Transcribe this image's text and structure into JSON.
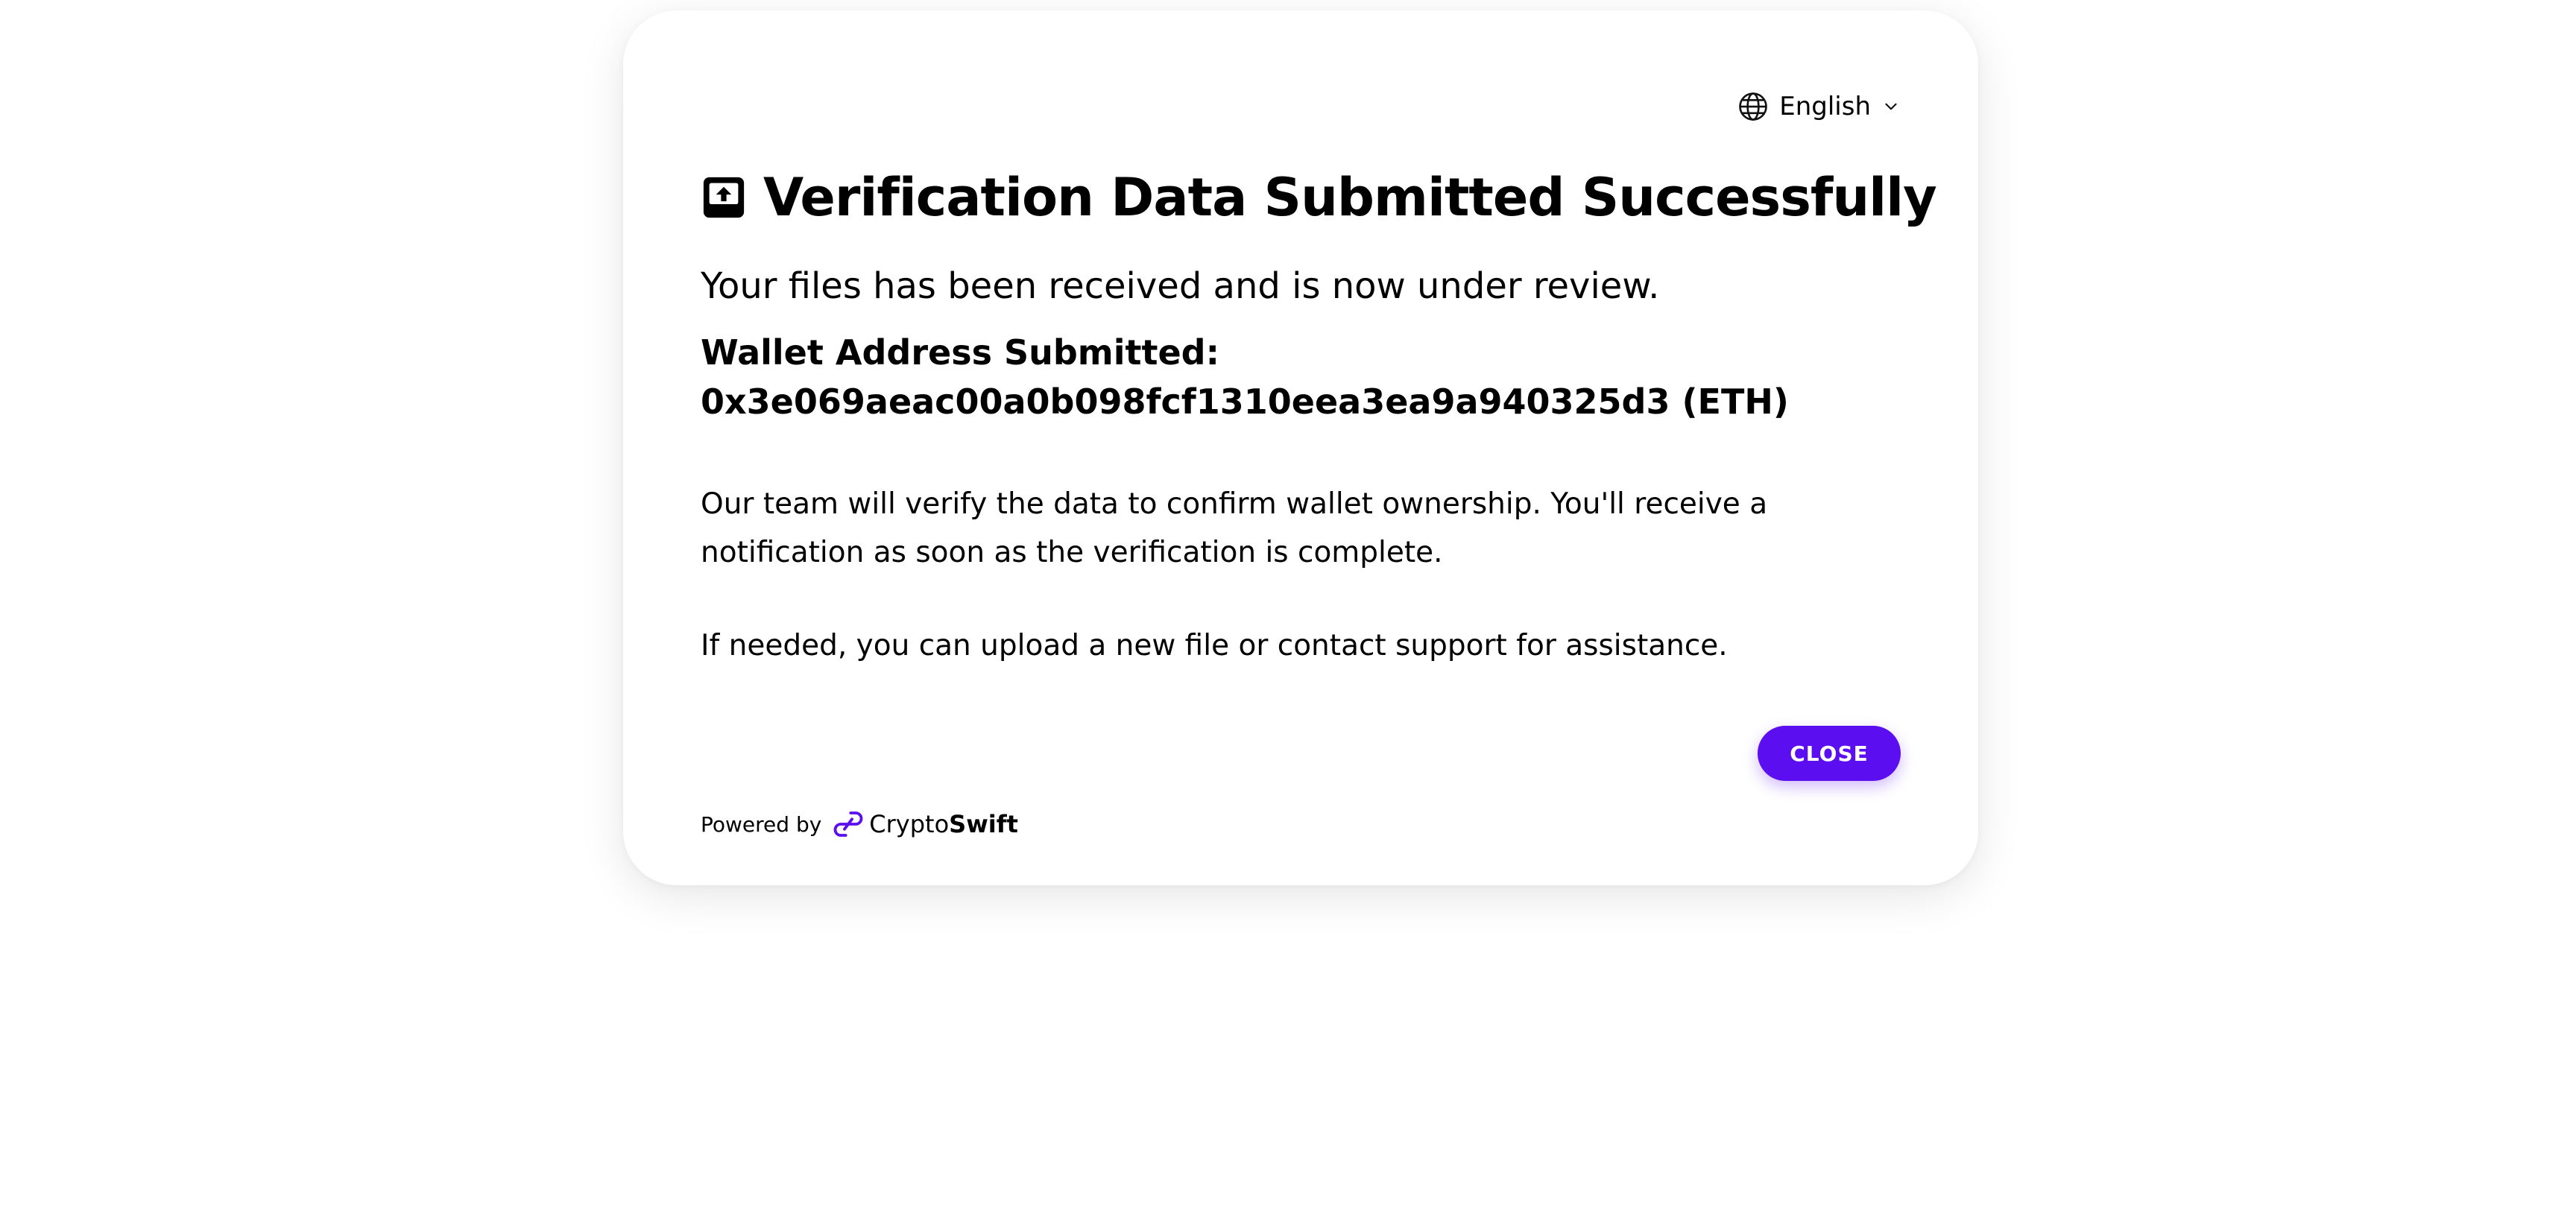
{
  "language": {
    "label": "English"
  },
  "dialog": {
    "title": "Verification Data Submitted Successfully",
    "intro": "Your files has been received and is now under review.",
    "wallet_label": "Wallet Address Submitted:",
    "wallet_address": "0x3e069aeac00a0b098fcf1310eea3ea9a940325d3 (ETH)",
    "paragraph_1": "Our team will verify the data to confirm wallet ownership. You'll receive a notification as soon as the verification is complete.",
    "paragraph_2": "If needed, you can upload a new file or contact support for assistance.",
    "close_label": "CLOSE"
  },
  "footer": {
    "powered_by": "Powered by",
    "brand_prefix": "Crypto",
    "brand_suffix": "Swift"
  },
  "colors": {
    "accent": "#5b0ef0",
    "text": "#000000",
    "background": "#ffffff"
  },
  "icons": {
    "language": "globe-icon",
    "dropdown": "chevron-down-icon",
    "title": "upload-box-icon",
    "brand": "cryptoswift-logo-icon"
  }
}
